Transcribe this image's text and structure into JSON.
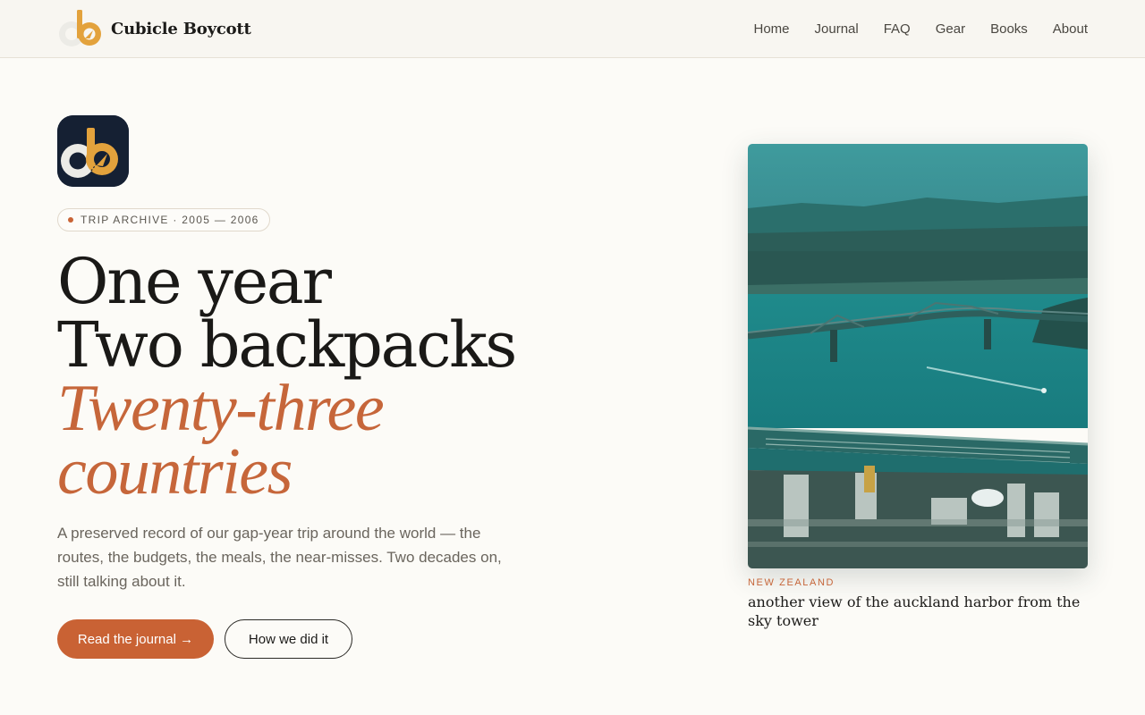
{
  "brand": {
    "name": "Cubicle Boycott",
    "logo_icon": "cb-logo-icon"
  },
  "nav": {
    "items": [
      "Home",
      "Journal",
      "FAQ",
      "Gear",
      "Books",
      "About"
    ]
  },
  "hero": {
    "app_icon": "cb-app-icon",
    "badge": "TRIP ARCHIVE · 2005 — 2006",
    "headline": {
      "line1": "One year",
      "line2": "Two backpacks",
      "line3": "Twenty-three",
      "line4": "countries"
    },
    "lede": "A preserved record of our gap-year trip around the world — the routes, the budgets, the meals, the near-misses. Two decades on, still talking about it.",
    "primary_cta": "Read the journal →",
    "secondary_cta": "How we did it"
  },
  "photo": {
    "country": "NEW ZEALAND",
    "caption": "another view of the auckland harbor from the sky tower"
  },
  "colors": {
    "background": "#fcfbf7",
    "header": "#f8f6f1",
    "accent": "#c96234",
    "ink": "#1c1b19",
    "muted": "#6a655d",
    "app_icon_bg": "#152033",
    "logo_orange": "#e3a23c"
  }
}
